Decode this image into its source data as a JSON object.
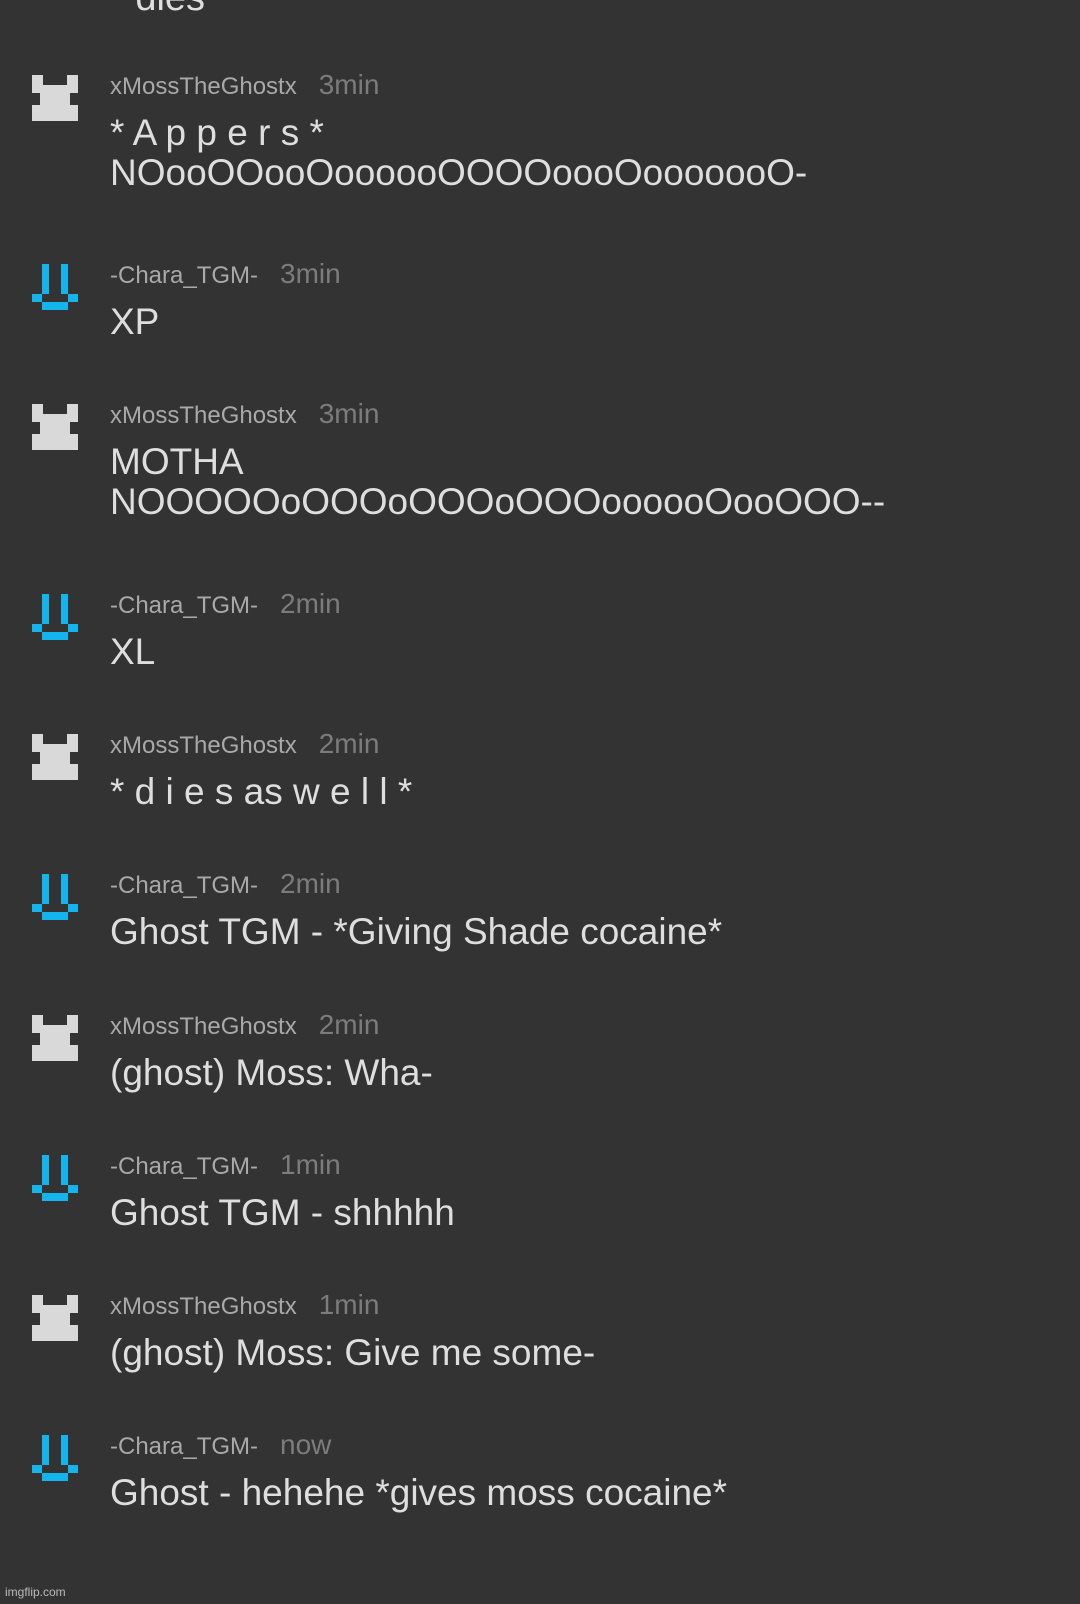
{
  "top_cut_text": "* dies *",
  "colors": {
    "background": "#333333",
    "moss_avatar": "#d9d9d9",
    "chara_avatar": "#14b4ec"
  },
  "messages": [
    {
      "user": "xMossTheGhostx",
      "time": "3min",
      "avatar": "moss-avatar-icon",
      "lines": [
        "* A p p e r s *",
        "NOooOOooOoooooOOOOoooOooooooO-"
      ]
    },
    {
      "user": "-Chara_TGM-",
      "time": "3min",
      "avatar": "chara-avatar-icon",
      "lines": [
        "XP"
      ]
    },
    {
      "user": "xMossTheGhostx",
      "time": "3min",
      "avatar": "moss-avatar-icon",
      "lines": [
        "MOTHA",
        "NOOOOOoOOOoOOOoOOOoooooOooOOO--"
      ]
    },
    {
      "user": "-Chara_TGM-",
      "time": "2min",
      "avatar": "chara-avatar-icon",
      "lines": [
        "XL"
      ]
    },
    {
      "user": "xMossTheGhostx",
      "time": "2min",
      "avatar": "moss-avatar-icon",
      "lines": [
        "* d i e s as w e l l *"
      ]
    },
    {
      "user": "-Chara_TGM-",
      "time": "2min",
      "avatar": "chara-avatar-icon",
      "lines": [
        "Ghost TGM - *Giving Shade cocaine*"
      ]
    },
    {
      "user": "xMossTheGhostx",
      "time": "2min",
      "avatar": "moss-avatar-icon",
      "lines": [
        "(ghost) Moss: Wha-"
      ]
    },
    {
      "user": "-Chara_TGM-",
      "time": "1min",
      "avatar": "chara-avatar-icon",
      "lines": [
        "Ghost TGM - shhhhh"
      ]
    },
    {
      "user": "xMossTheGhostx",
      "time": "1min",
      "avatar": "moss-avatar-icon",
      "lines": [
        "(ghost) Moss: Give me some-"
      ]
    },
    {
      "user": "-Chara_TGM-",
      "time": "now",
      "avatar": "chara-avatar-icon",
      "lines": [
        "Ghost - hehehe *gives moss cocaine*"
      ]
    }
  ],
  "watermark": "imgflip.com"
}
